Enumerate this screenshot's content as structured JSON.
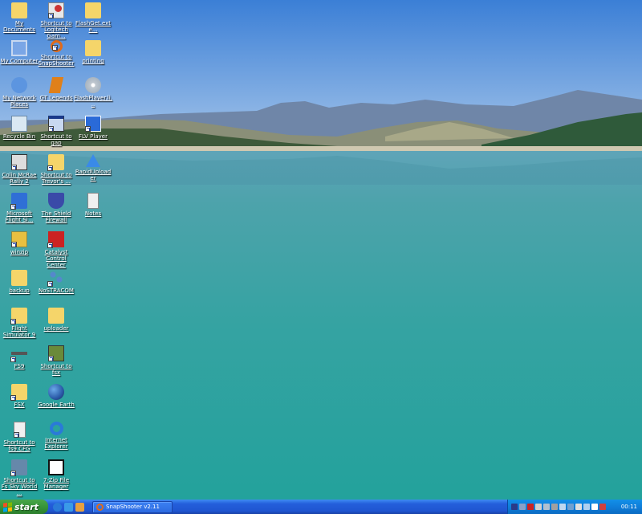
{
  "desktop": {
    "icons": [
      {
        "label": "My Documents",
        "icon": "folder-docs-icon",
        "color": "#f5d56a"
      },
      {
        "label": "My Computer",
        "icon": "computer-icon",
        "color": "#7aa6e6"
      },
      {
        "label": "My Network Places",
        "icon": "network-icon",
        "color": "#5c95e0"
      },
      {
        "label": "Recycle Bin",
        "icon": "recycle-bin-icon",
        "color": "#d9e8f2"
      },
      {
        "label": "Colin McRae Rally 2",
        "icon": "colin-mcrae-icon",
        "color": "#dddddd"
      },
      {
        "label": "Microsoft Flight Si...",
        "icon": "flight-sim-icon",
        "color": "#2f6fd6"
      },
      {
        "label": "winzip",
        "icon": "winzip-icon",
        "color": "#e8c040"
      },
      {
        "label": "backup",
        "icon": "folder-icon",
        "color": "#f5d56a"
      },
      {
        "label": "Flight Simulator 9",
        "icon": "folder-icon",
        "color": "#f5d56a"
      },
      {
        "label": "FS9",
        "icon": "airplane-icon",
        "color": "#555555"
      },
      {
        "label": "FSX",
        "icon": "folder-icon",
        "color": "#f5d56a"
      },
      {
        "label": "Shortcut to fs9.CFG",
        "icon": "cfg-file-icon",
        "color": "#f0f0f0"
      },
      {
        "label": "Shortcut to Fs Sky World ...",
        "icon": "sky-world-icon",
        "color": "#6688aa"
      },
      {
        "label": "Shortcut to Logitech Gam...",
        "icon": "logitech-icon",
        "color": "#cc3333"
      },
      {
        "label": "Shortcut to SnapShooter",
        "icon": "magnifier-icon",
        "color": "#e06a1a"
      },
      {
        "label": "GT Legends",
        "icon": "gt-legends-icon",
        "color": "#e0801a"
      },
      {
        "label": "Shortcut to gap",
        "icon": "window-icon",
        "color": "#c8d8f0"
      },
      {
        "label": "Shortcut to Trevor's ...",
        "icon": "folder-icon",
        "color": "#f5d56a"
      },
      {
        "label": "The Shield Firewall",
        "icon": "shield-icon",
        "color": "#3a4aa8"
      },
      {
        "label": "Catalyst Control Center",
        "icon": "ati-icon",
        "color": "#cc2222"
      },
      {
        "label": "NoSTRACOM",
        "icon": "network-nodes-icon",
        "color": "#5588cc"
      },
      {
        "label": "uploader",
        "icon": "folder-icon",
        "color": "#f5d56a"
      },
      {
        "label": "Shortcut to fsx",
        "icon": "fsx-icon",
        "color": "#6a8a3a"
      },
      {
        "label": "Google Earth",
        "icon": "globe-icon",
        "color": "#2a5aa8"
      },
      {
        "label": "Internet Explorer",
        "icon": "ie-icon",
        "color": "#2a7ad8"
      },
      {
        "label": "7-Zip File Manager",
        "icon": "7zip-icon",
        "color": "#111111"
      },
      {
        "label": "FlashGet.exte...",
        "icon": "folder-icon",
        "color": "#f5d56a"
      },
      {
        "label": "printing",
        "icon": "folder-icon",
        "color": "#f5d56a"
      },
      {
        "label": "FlashPlayer.li...",
        "icon": "cd-icon",
        "color": "#c0c8d0"
      },
      {
        "label": "FLV Player",
        "icon": "flv-player-icon",
        "color": "#2a6ad8"
      },
      {
        "label": "RapidUploader",
        "icon": "upload-arrow-icon",
        "color": "#3a8ae8"
      },
      {
        "label": "Notes",
        "icon": "text-file-icon",
        "color": "#f0f0f0"
      }
    ]
  },
  "taskbar": {
    "start_label": "start",
    "task_label": "SnapShooter v2.11",
    "clock": "00:11",
    "quick_launch": [
      {
        "icon": "ie-quicklaunch-icon",
        "color": "#2a7ad8"
      },
      {
        "icon": "refresh-quicklaunch-icon",
        "color": "#3a9ae8"
      },
      {
        "icon": "media-quicklaunch-icon",
        "color": "#e8a040"
      }
    ],
    "tray": [
      {
        "icon": "shield-tray-icon",
        "color": "#2a3a88"
      },
      {
        "icon": "network-tray-icon",
        "color": "#8aa0c8"
      },
      {
        "icon": "ati-tray-icon",
        "color": "#cc2222"
      },
      {
        "icon": "volume-tray-icon",
        "color": "#d0d0d0"
      },
      {
        "icon": "speaker-tray-icon",
        "color": "#b0c0d0"
      },
      {
        "icon": "gear-tray-icon",
        "color": "#a0a0a0"
      },
      {
        "icon": "monitor-tray-icon",
        "color": "#c0d8f0"
      },
      {
        "icon": "connection-tray-icon",
        "color": "#70a0d0"
      },
      {
        "icon": "sync-tray-icon",
        "color": "#e0e0e0"
      },
      {
        "icon": "cloud-tray-icon",
        "color": "#b0d0f0"
      },
      {
        "icon": "v-tray-icon",
        "color": "#ffffff"
      },
      {
        "icon": "antivirus-tray-icon",
        "color": "#d04040"
      }
    ]
  }
}
